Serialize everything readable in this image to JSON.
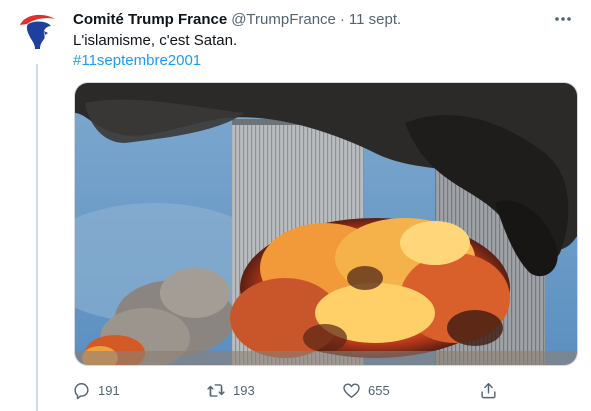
{
  "tweet": {
    "author_name": "Comité Trump France",
    "author_handle": "@TrumpFrance",
    "separator": "·",
    "date": "11 sept.",
    "text": "L'islamisme, c'est Satan.",
    "hashtag": "#11septembre2001",
    "media_description": "photo"
  },
  "actions": {
    "replies": "191",
    "retweets": "193",
    "likes": "655"
  },
  "icons": {
    "more": "more-icon",
    "reply": "reply-icon",
    "retweet": "retweet-icon",
    "like": "like-icon",
    "share": "share-icon"
  },
  "colors": {
    "link": "#1d9bf0",
    "secondary_text": "#536471",
    "primary_text": "#0f1419",
    "avatar_red": "#e0312c",
    "avatar_blue": "#1f3f9c"
  }
}
